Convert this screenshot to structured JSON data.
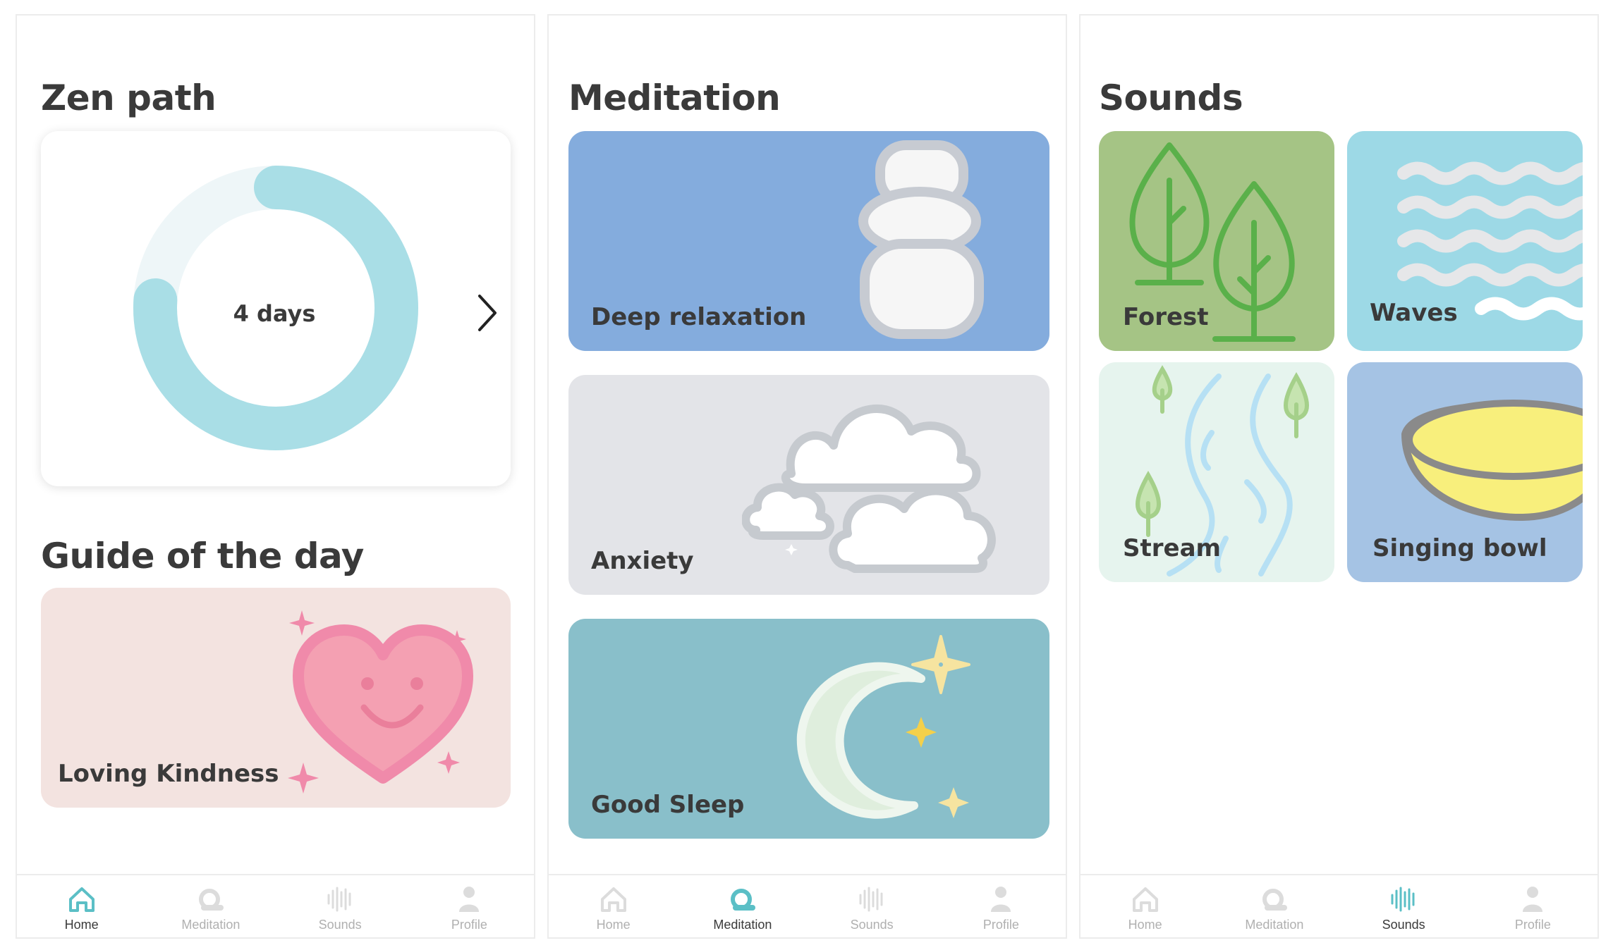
{
  "home": {
    "title": "Zen path",
    "streak": {
      "label": "4 days",
      "progress": 0.76
    },
    "guide_heading": "Guide of the day",
    "guide_card": {
      "label": "Loving Kindness"
    }
  },
  "meditation": {
    "title": "Meditation",
    "cards": [
      {
        "label": "Deep relaxation",
        "color": "#84acdd"
      },
      {
        "label": "Anxiety",
        "color": "#e3e4e8"
      },
      {
        "label": "Good Sleep",
        "color": "#89bfca"
      }
    ]
  },
  "sounds": {
    "title": "Sounds",
    "tiles": [
      {
        "label": "Forest",
        "color": "#a5c485"
      },
      {
        "label": "Waves",
        "color": "#9dd9e6"
      },
      {
        "label": "Stream",
        "color": "#e6f4ee"
      },
      {
        "label": "Singing bowl",
        "color": "#a5c3e4"
      }
    ]
  },
  "tabbar": {
    "tabs": [
      {
        "label": "Home",
        "icon": "home-icon"
      },
      {
        "label": "Meditation",
        "icon": "meditation-icon"
      },
      {
        "label": "Sounds",
        "icon": "sounds-icon"
      },
      {
        "label": "Profile",
        "icon": "profile-icon"
      }
    ],
    "active_color": "#5bbfc6",
    "inactive_color": "#dcdcdc"
  }
}
